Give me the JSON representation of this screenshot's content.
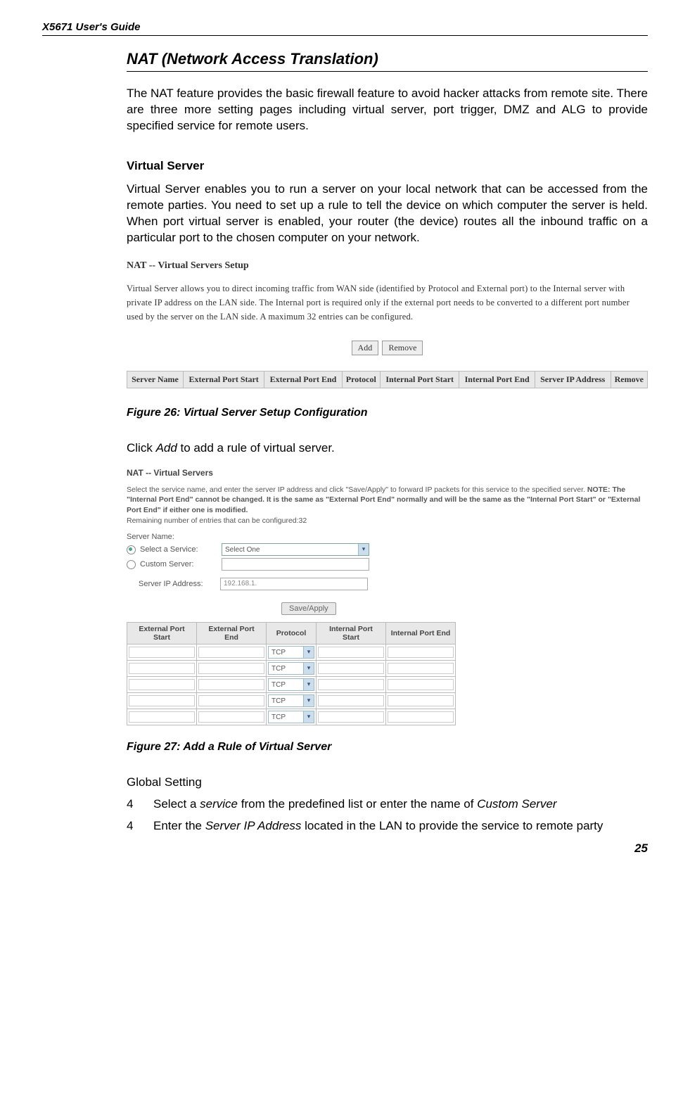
{
  "header": "X5671 User's Guide",
  "title": "NAT (Network Access Translation)",
  "intro": "The NAT feature provides the basic firewall feature to avoid hacker attacks from remote site. There are three more setting pages including virtual server, port trigger, DMZ and ALG to provide specified service for remote users.",
  "vs_heading": "Virtual Server",
  "vs_text": "Virtual Server enables you to run a server on your local network that can be accessed from the remote parties. You need to set up a rule to tell the device on which computer the server is held. When port virtual server is enabled, your router (the device) routes all the inbound traffic on a particular port to the chosen computer on your network.",
  "fig26": {
    "title": "NAT -- Virtual Servers Setup",
    "desc": "Virtual Server allows you to direct incoming traffic from WAN side (identified by Protocol and External port) to the Internal server with private IP address on the LAN side. The Internal port is required only if the external port needs to be converted to a different port number used by the server on the LAN side. A maximum 32 entries can be configured.",
    "add": "Add",
    "remove": "Remove",
    "headers": [
      "Server Name",
      "External Port Start",
      "External Port End",
      "Protocol",
      "Internal Port Start",
      "Internal Port End",
      "Server IP Address",
      "Remove"
    ],
    "caption": "Figure 26: Virtual Server Setup Configuration"
  },
  "click_text_pre": "Click ",
  "click_text_em": "Add",
  "click_text_post": " to add a rule of virtual server.",
  "fig27": {
    "title": "NAT -- Virtual Servers",
    "desc_plain": "Select the service name, and enter the server IP address and click \"Save/Apply\" to forward IP packets for this service to the specified server. ",
    "desc_bold": "NOTE: The \"Internal Port End\" cannot be changed. It is the same as \"External Port End\" normally and will be the same as the \"Internal Port Start\" or \"External Port End\" if either one is modified.",
    "remaining": "Remaining number of entries that can be configured:32",
    "server_name_label": "Server Name:",
    "select_service": "Select a Service:",
    "select_one": "Select One",
    "custom_server": "Custom Server:",
    "server_ip_label": "Server IP Address:",
    "server_ip_value": "192.168.1.",
    "save_apply": "Save/Apply",
    "headers": [
      "External Port Start",
      "External Port End",
      "Protocol",
      "Internal Port Start",
      "Internal Port End"
    ],
    "proto": "TCP",
    "rows": 5,
    "caption": "Figure 27: Add a Rule of Virtual Server"
  },
  "global_heading": "Global Setting",
  "list": [
    {
      "n": "4",
      "pre": "Select a ",
      "em1": "service",
      "mid": " from the predefined list or enter the name of ",
      "em2": "Custom Server",
      "post": ""
    },
    {
      "n": "4",
      "pre": "Enter the ",
      "em1": "Server IP Address",
      "mid": " located in the LAN to provide the service to remote party",
      "em2": "",
      "post": ""
    }
  ],
  "page_number": "25"
}
